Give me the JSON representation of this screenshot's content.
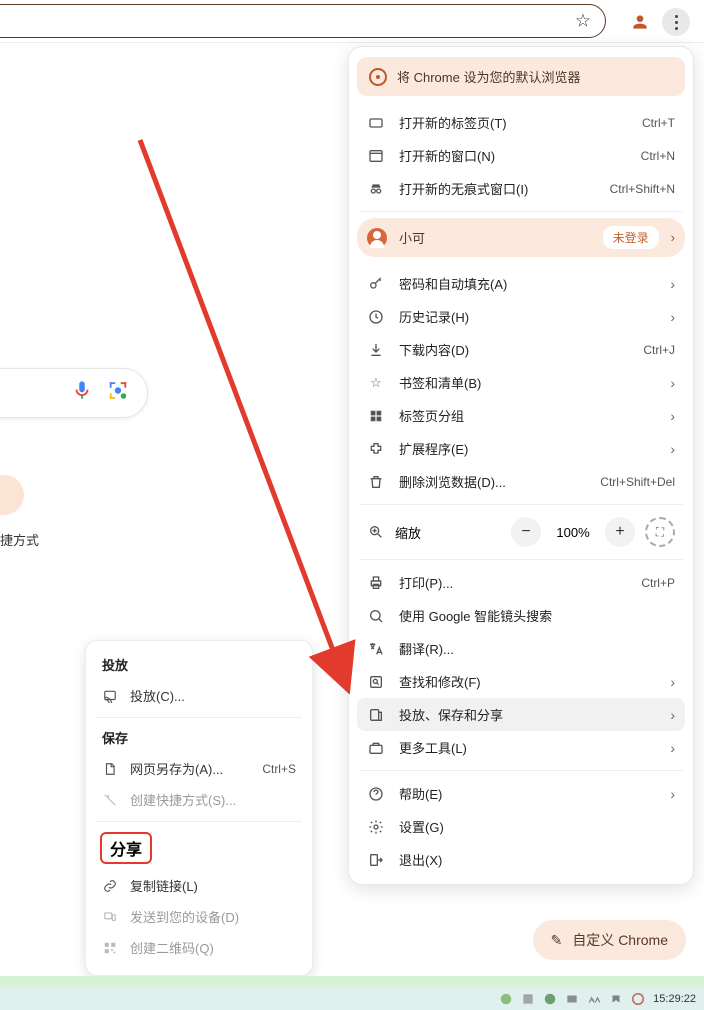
{
  "banner": {
    "text": "将 Chrome 设为您的默认浏览器"
  },
  "profile": {
    "name": "小可",
    "badge": "未登录"
  },
  "zoom": {
    "label": "缩放",
    "value": "100%"
  },
  "menu": {
    "new_tab": {
      "label": "打开新的标签页(T)",
      "shortcut": "Ctrl+T"
    },
    "new_window": {
      "label": "打开新的窗口(N)",
      "shortcut": "Ctrl+N"
    },
    "new_incognito": {
      "label": "打开新的无痕式窗口(I)",
      "shortcut": "Ctrl+Shift+N"
    },
    "passwords": {
      "label": "密码和自动填充(A)"
    },
    "history": {
      "label": "历史记录(H)"
    },
    "downloads": {
      "label": "下载内容(D)",
      "shortcut": "Ctrl+J"
    },
    "bookmarks": {
      "label": "书签和清单(B)"
    },
    "tab_groups": {
      "label": "标签页分组"
    },
    "extensions": {
      "label": "扩展程序(E)"
    },
    "clear_data": {
      "label": "删除浏览数据(D)...",
      "shortcut": "Ctrl+Shift+Del"
    },
    "print": {
      "label": "打印(P)...",
      "shortcut": "Ctrl+P"
    },
    "lens": {
      "label": "使用 Google 智能镜头搜索"
    },
    "translate": {
      "label": "翻译(R)..."
    },
    "find_edit": {
      "label": "查找和修改(F)"
    },
    "cast_share": {
      "label": "投放、保存和分享"
    },
    "more_tools": {
      "label": "更多工具(L)"
    },
    "help": {
      "label": "帮助(E)"
    },
    "settings": {
      "label": "设置(G)"
    },
    "exit": {
      "label": "退出(X)"
    }
  },
  "submenu": {
    "cast_h": "投放",
    "cast": {
      "label": "投放(C)..."
    },
    "save_h": "保存",
    "save_as": {
      "label": "网页另存为(A)...",
      "shortcut": "Ctrl+S"
    },
    "shortcut": {
      "label": "创建快捷方式(S)..."
    },
    "share_h": "分享",
    "copy_link": {
      "label": "复制链接(L)"
    },
    "send_device": {
      "label": "发送到您的设备(D)"
    },
    "qr": {
      "label": "创建二维码(Q)"
    }
  },
  "blob_text": "捷方式",
  "customize": {
    "label": "自定义 Chrome"
  },
  "taskbar": {
    "time": "15:29:22"
  }
}
